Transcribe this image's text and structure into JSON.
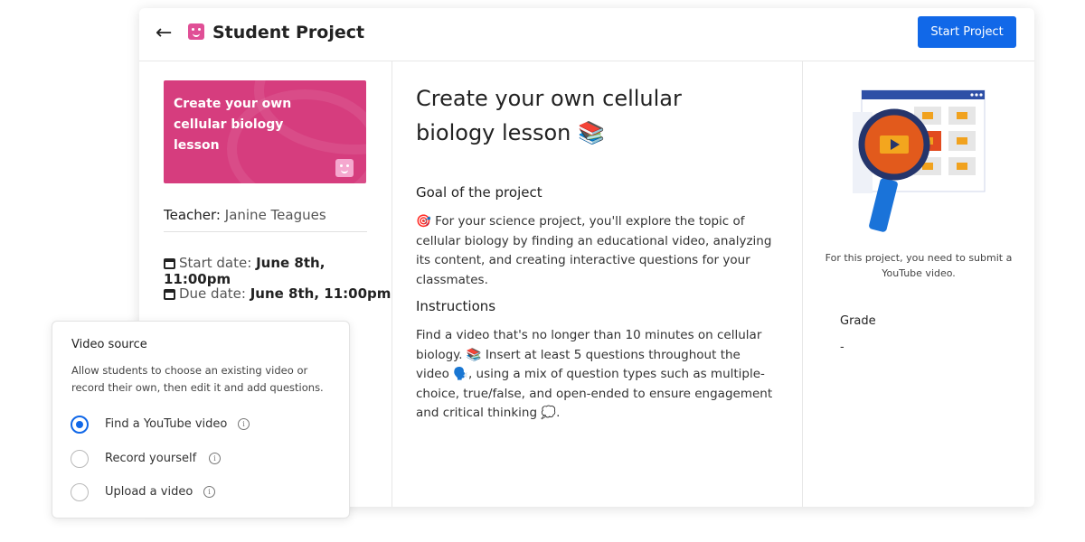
{
  "header": {
    "title": "Student Project",
    "start_button": "Start Project"
  },
  "left": {
    "thumbnail_text": "Create your own cellular biology lesson",
    "teacher_label": "Teacher:",
    "teacher_name": "Janine Teagues",
    "start_label": "Start date:",
    "start_value": "June 8th, 11:00pm",
    "due_label": "Due date:",
    "due_value": "June 8th, 11:00pm"
  },
  "center": {
    "lesson_title": "Create your own cellular biology lesson 📚",
    "goal_heading": "Goal of the project",
    "goal_text": "🎯 For your science project, you'll explore the topic of cellular biology by finding an educational video, analyzing its content, and creating interactive questions for your classmates.",
    "instructions_heading": "Instructions",
    "instructions_text": "Find a video that's no longer than 10 minutes on cellular biology. 📚 Insert at least 5 questions throughout the video 🗣️, using a mix of question types such as multiple-choice, true/false, and open-ended to ensure engagement and critical thinking 💭."
  },
  "right": {
    "caption": "For this project, you need to submit a YouTube video.",
    "grade_label": "Grade",
    "grade_value": "-"
  },
  "video_source": {
    "title": "Video source",
    "description": "Allow students to choose an existing video or record their own, then edit it and add questions.",
    "options": [
      {
        "label": "Find a YouTube video",
        "selected": true
      },
      {
        "label": "Record yourself",
        "selected": false
      },
      {
        "label": "Upload a video",
        "selected": false
      }
    ],
    "info_glyph": "i"
  },
  "colors": {
    "accent": "#1168e8",
    "thumbnail": "#d63d7e",
    "brand_badge": "#e04f96"
  }
}
